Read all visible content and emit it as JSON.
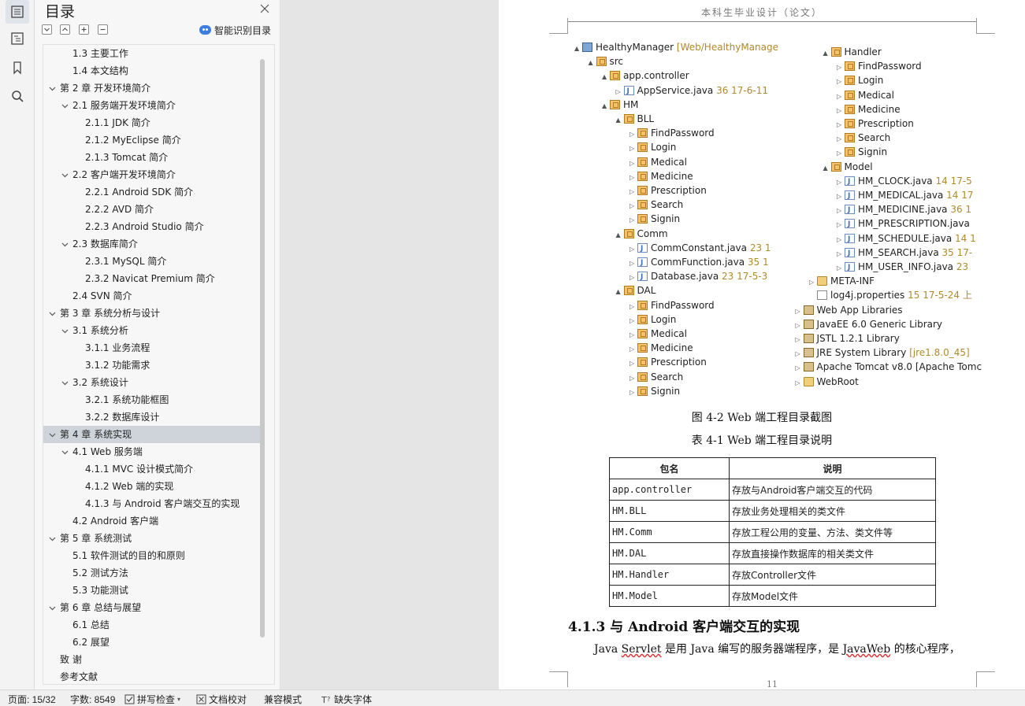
{
  "toc_panel": {
    "title": "目录",
    "smart_label": "智能识别目录",
    "items": [
      {
        "text": "1.3  主要工作",
        "level": 2,
        "caret": false
      },
      {
        "text": "1.4  本文结构",
        "level": 2,
        "caret": false
      },
      {
        "text": "第 2 章  开发环境简介",
        "level": 1,
        "caret": true
      },
      {
        "text": "2.1  服务端开发环境简介",
        "level": 2,
        "caret": true
      },
      {
        "text": "2.1.1 JDK 简介",
        "level": 3,
        "caret": false
      },
      {
        "text": "2.1.2 MyEclipse 简介",
        "level": 3,
        "caret": false
      },
      {
        "text": "2.1.3 Tomcat 简介",
        "level": 3,
        "caret": false
      },
      {
        "text": "2.2  客户端开发环境简介",
        "level": 2,
        "caret": true
      },
      {
        "text": "2.2.1 Android SDK 简介",
        "level": 3,
        "caret": false
      },
      {
        "text": "2.2.2 AVD 简介",
        "level": 3,
        "caret": false
      },
      {
        "text": "2.2.3 Android Studio 简介",
        "level": 3,
        "caret": false
      },
      {
        "text": "2.3  数据库简介",
        "level": 2,
        "caret": true
      },
      {
        "text": "2.3.1 MySQL 简介",
        "level": 3,
        "caret": false
      },
      {
        "text": "2.3.2 Navicat Premium 简介",
        "level": 3,
        "caret": false
      },
      {
        "text": "2.4 SVN 简介",
        "level": 2,
        "caret": false
      },
      {
        "text": "第 3 章  系统分析与设计",
        "level": 1,
        "caret": true
      },
      {
        "text": "3.1  系统分析",
        "level": 2,
        "caret": true
      },
      {
        "text": "3.1.1  业务流程",
        "level": 3,
        "caret": false
      },
      {
        "text": "3.1.2  功能需求",
        "level": 3,
        "caret": false
      },
      {
        "text": "3.2  系统设计",
        "level": 2,
        "caret": true
      },
      {
        "text": "3.2.1  系统功能框图",
        "level": 3,
        "caret": false
      },
      {
        "text": "3.2.2  数据库设计",
        "level": 3,
        "caret": false
      },
      {
        "text": "第 4 章  系统实现",
        "level": 1,
        "caret": true,
        "selected": true
      },
      {
        "text": "4.1 Web 服务端",
        "level": 2,
        "caret": true
      },
      {
        "text": "4.1.1 MVC 设计模式简介",
        "level": 3,
        "caret": false
      },
      {
        "text": "4.1.2 Web 端的实现",
        "level": 3,
        "caret": false
      },
      {
        "text": "4.1.3  与 Android 客户端交互的实现",
        "level": 3,
        "caret": false
      },
      {
        "text": "4.2 Android 客户端",
        "level": 2,
        "caret": false
      },
      {
        "text": "第 5 章  系统测试",
        "level": 1,
        "caret": true
      },
      {
        "text": "5.1  软件测试的目的和原则",
        "level": 2,
        "caret": false
      },
      {
        "text": "5.2  测试方法",
        "level": 2,
        "caret": false
      },
      {
        "text": "5.3  功能测试",
        "level": 2,
        "caret": false
      },
      {
        "text": "第 6 章  总结与展望",
        "level": 1,
        "caret": true
      },
      {
        "text": "6.1  总结",
        "level": 2,
        "caret": false
      },
      {
        "text": "6.2  展望",
        "level": 2,
        "caret": false
      },
      {
        "text": "致  谢",
        "level": 1,
        "caret": false
      },
      {
        "text": "参考文献",
        "level": 1,
        "caret": false
      }
    ]
  },
  "document": {
    "running_header": "本科生毕业设计（论文）",
    "tree": {
      "left": [
        {
          "text": "HealthyManager",
          "extra": " [Web/HealthyManage",
          "depth": 0,
          "icon": "proj",
          "arrow": "▲"
        },
        {
          "text": "src",
          "extra": "",
          "depth": 1,
          "icon": "pkg",
          "arrow": "▲"
        },
        {
          "text": "app.controller",
          "extra": "",
          "depth": 2,
          "icon": "pkg",
          "arrow": "▲"
        },
        {
          "text": "AppService.java",
          "extra": " 36  17-6-11",
          "depth": 3,
          "icon": "java",
          "arrow": "▷"
        },
        {
          "text": "HM",
          "extra": "",
          "depth": 2,
          "icon": "pkg",
          "arrow": "▲"
        },
        {
          "text": "BLL",
          "extra": "",
          "depth": 3,
          "icon": "pkg",
          "arrow": "▲"
        },
        {
          "text": "FindPassword",
          "extra": "",
          "depth": 4,
          "icon": "pkg",
          "arrow": "▷"
        },
        {
          "text": "Login",
          "extra": "",
          "depth": 4,
          "icon": "pkg",
          "arrow": "▷"
        },
        {
          "text": "Medical",
          "extra": "",
          "depth": 4,
          "icon": "pkg",
          "arrow": "▷"
        },
        {
          "text": "Medicine",
          "extra": "",
          "depth": 4,
          "icon": "pkg",
          "arrow": "▷"
        },
        {
          "text": "Prescription",
          "extra": "",
          "depth": 4,
          "icon": "pkg",
          "arrow": "▷"
        },
        {
          "text": "Search",
          "extra": "",
          "depth": 4,
          "icon": "pkg",
          "arrow": "▷"
        },
        {
          "text": "Signin",
          "extra": "",
          "depth": 4,
          "icon": "pkg",
          "arrow": "▷"
        },
        {
          "text": "Comm",
          "extra": "",
          "depth": 3,
          "icon": "pkg",
          "arrow": "▲"
        },
        {
          "text": "CommConstant.java",
          "extra": " 23  1",
          "depth": 4,
          "icon": "java",
          "arrow": "▷"
        },
        {
          "text": "CommFunction.java",
          "extra": " 35  1",
          "depth": 4,
          "icon": "java",
          "arrow": "▷"
        },
        {
          "text": "Database.java",
          "extra": " 23  17-5-3",
          "depth": 4,
          "icon": "java",
          "arrow": "▷"
        },
        {
          "text": "DAL",
          "extra": "",
          "depth": 3,
          "icon": "pkg",
          "arrow": "▲"
        },
        {
          "text": "FindPassword",
          "extra": "",
          "depth": 4,
          "icon": "pkg",
          "arrow": "▷"
        },
        {
          "text": "Login",
          "extra": "",
          "depth": 4,
          "icon": "pkg",
          "arrow": "▷"
        },
        {
          "text": "Medical",
          "extra": "",
          "depth": 4,
          "icon": "pkg",
          "arrow": "▷"
        },
        {
          "text": "Medicine",
          "extra": "",
          "depth": 4,
          "icon": "pkg",
          "arrow": "▷"
        },
        {
          "text": "Prescription",
          "extra": "",
          "depth": 4,
          "icon": "pkg",
          "arrow": "▷"
        },
        {
          "text": "Search",
          "extra": "",
          "depth": 4,
          "icon": "pkg",
          "arrow": "▷"
        },
        {
          "text": "Signin",
          "extra": "",
          "depth": 4,
          "icon": "pkg",
          "arrow": "▷"
        }
      ],
      "right": [
        {
          "text": "Handler",
          "extra": "",
          "depth": 1,
          "icon": "pkg",
          "arrow": "▲"
        },
        {
          "text": "FindPassword",
          "extra": "",
          "depth": 2,
          "icon": "pkg",
          "arrow": "▷"
        },
        {
          "text": "Login",
          "extra": "",
          "depth": 2,
          "icon": "pkg",
          "arrow": "▷"
        },
        {
          "text": "Medical",
          "extra": "",
          "depth": 2,
          "icon": "pkg",
          "arrow": "▷"
        },
        {
          "text": "Medicine",
          "extra": "",
          "depth": 2,
          "icon": "pkg",
          "arrow": "▷"
        },
        {
          "text": "Prescription",
          "extra": "",
          "depth": 2,
          "icon": "pkg",
          "arrow": "▷"
        },
        {
          "text": "Search",
          "extra": "",
          "depth": 2,
          "icon": "pkg",
          "arrow": "▷"
        },
        {
          "text": "Signin",
          "extra": "",
          "depth": 2,
          "icon": "pkg",
          "arrow": "▷"
        },
        {
          "text": "Model",
          "extra": "",
          "depth": 1,
          "icon": "pkg",
          "arrow": "▲"
        },
        {
          "text": "HM_CLOCK.java",
          "extra": " 14  17-5",
          "depth": 2,
          "icon": "java",
          "arrow": "▷"
        },
        {
          "text": "HM_MEDICAL.java",
          "extra": " 14  17",
          "depth": 2,
          "icon": "java",
          "arrow": "▷"
        },
        {
          "text": "HM_MEDICINE.java",
          "extra": " 36  1",
          "depth": 2,
          "icon": "java",
          "arrow": "▷"
        },
        {
          "text": "HM_PRESCRIPTION.java",
          "extra": "",
          "depth": 2,
          "icon": "java",
          "arrow": "▷"
        },
        {
          "text": "HM_SCHEDULE.java",
          "extra": " 14  1",
          "depth": 2,
          "icon": "java",
          "arrow": "▷"
        },
        {
          "text": "HM_SEARCH.java",
          "extra": " 35  17-",
          "depth": 2,
          "icon": "java",
          "arrow": "▷"
        },
        {
          "text": "HM_USER_INFO.java",
          "extra": " 23",
          "depth": 2,
          "icon": "java",
          "arrow": "▷"
        },
        {
          "text": "META-INF",
          "extra": "",
          "depth": 0,
          "icon": "folder",
          "arrow": "▷"
        },
        {
          "text": "log4j.properties",
          "extra": " 15  17-5-24 上",
          "depth": 0,
          "icon": "prop",
          "arrow": ""
        },
        {
          "text": "Web App Libraries",
          "extra": "",
          "depth": -1,
          "icon": "lib",
          "arrow": "▷"
        },
        {
          "text": "JavaEE 6.0 Generic Library",
          "extra": "",
          "depth": -1,
          "icon": "lib",
          "arrow": "▷"
        },
        {
          "text": "JSTL 1.2.1 Library",
          "extra": "",
          "depth": -1,
          "icon": "lib",
          "arrow": "▷"
        },
        {
          "text": "JRE System Library",
          "extra": " [jre1.8.0_45]",
          "depth": -1,
          "icon": "lib",
          "arrow": "▷"
        },
        {
          "text": "Apache Tomcat v8.0 [Apache Tomc",
          "extra": "",
          "depth": -1,
          "icon": "lib",
          "arrow": "▷"
        },
        {
          "text": "WebRoot",
          "extra": "",
          "depth": -1,
          "icon": "folder",
          "arrow": "▷"
        }
      ]
    },
    "figure_caption": "图 4-2 Web 端工程目录截图",
    "table_caption": "表 4-1 Web 端工程目录说明",
    "table": {
      "headers": [
        "包名",
        "说明"
      ],
      "rows": [
        [
          "app.controller",
          "存放与Android客户端交互的代码"
        ],
        [
          "HM.BLL",
          "存放业务处理相关的类文件"
        ],
        [
          "HM.Comm",
          "存放工程公用的变量、方法、类文件等"
        ],
        [
          "HM.DAL",
          "存放直接操作数据库的相关类文件"
        ],
        [
          "HM.Handler",
          "存放Controller文件"
        ],
        [
          "HM.Model",
          "存放Model文件"
        ]
      ]
    },
    "section_heading": "4.1.3  与 Android 客户端交互的实现",
    "body": {
      "p1": "Java ",
      "u1": "Servlet",
      "p2": " 是用 Java 编写的服务器端程序，是 ",
      "u2": "JavaWeb",
      "p3": " 的核心程序，"
    },
    "page_number": "11"
  },
  "status_bar": {
    "page": "页面: 15/32",
    "words": "字数: 8549",
    "spell": "拼写检查",
    "proof": "文档校对",
    "compat": "兼容模式",
    "missing_font": "缺失字体"
  }
}
